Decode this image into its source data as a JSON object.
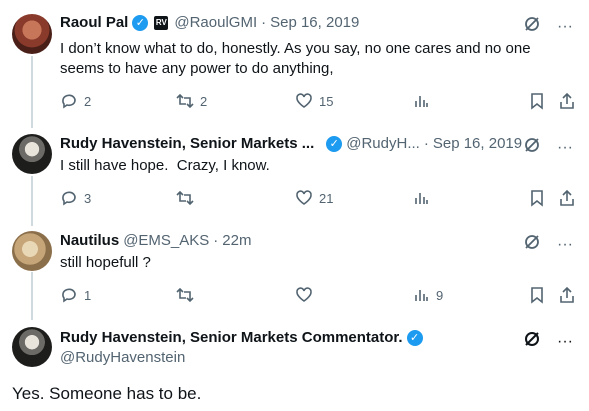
{
  "tweets": [
    {
      "name": "Raoul Pal",
      "handle": "@RaoulGMI",
      "date": "Sep 16, 2019",
      "affiliate_badge": "RV",
      "text": "I don’t know what to do, honestly. As you say, no one cares and no one seems to have any power to do anything,",
      "replies": "2",
      "retweets": "2",
      "likes": "15",
      "views": ""
    },
    {
      "name": "Rudy Havenstein, Senior Markets ...",
      "handle": "@RudyH...",
      "date": "Sep 16, 2019",
      "text": "I still have hope.  Crazy, I know.",
      "replies": "3",
      "retweets": "",
      "likes": "21",
      "views": ""
    },
    {
      "name": "Nautilus",
      "handle": "@EMS_AKS",
      "date": "22m",
      "text": "still hopefull ?",
      "replies": "1",
      "retweets": "",
      "likes": "",
      "views": "9"
    }
  ],
  "main_tweet": {
    "name": "Rudy Havenstein, Senior Markets Commentator.",
    "handle": "@RudyHavenstein",
    "text": "Yes. Someone has to be."
  },
  "separator": "·",
  "more": "···",
  "colors": {
    "verified": "#1d9bf0",
    "muted": "#536471",
    "text": "#0f1419",
    "thread": "#cfd9de"
  }
}
